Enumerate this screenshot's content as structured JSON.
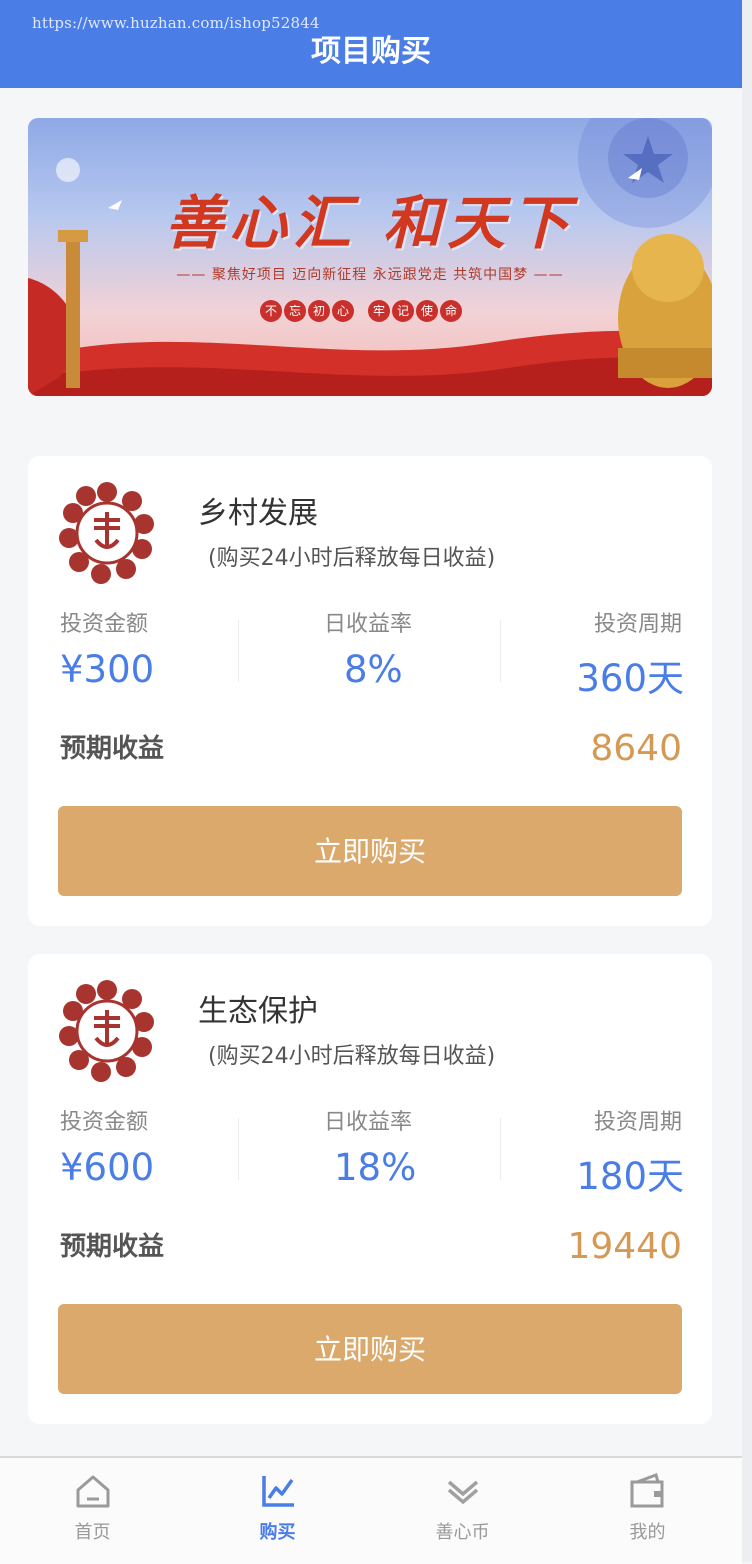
{
  "watermark": "https://www.huzhan.com/ishop52844",
  "header": {
    "title": "项目购买"
  },
  "banner": {
    "slogan": "善心汇 和天下",
    "subline": "—— 聚焦好项目 迈向新征程 永远跟党走 共筑中国梦 ——",
    "pills_left": [
      "不",
      "忘",
      "初",
      "心"
    ],
    "pills_right": [
      "牢",
      "记",
      "使",
      "命"
    ]
  },
  "labels": {
    "amount": "投资金额",
    "rate": "日收益率",
    "period": "投资周期",
    "expected": "预期收益",
    "buy": "立即购买"
  },
  "projects": [
    {
      "name": "乡村发展",
      "note": "(购买24小时后释放每日收益)",
      "amount": "¥300",
      "rate": "8%",
      "period": "360天",
      "expected": "8640"
    },
    {
      "name": "生态保护",
      "note": "(购买24小时后释放每日收益)",
      "amount": "¥600",
      "rate": "18%",
      "period": "180天",
      "expected": "19440"
    }
  ],
  "tabbar": {
    "items": [
      {
        "label": "首页",
        "icon": "home-icon"
      },
      {
        "label": "购买",
        "icon": "chart-icon",
        "active": true
      },
      {
        "label": "善心币",
        "icon": "chevron-double-icon"
      },
      {
        "label": "我的",
        "icon": "wallet-icon"
      }
    ]
  },
  "colors": {
    "header": "#4a7de6",
    "accent_blue": "#4a7de6",
    "gold": "#dba96b",
    "expected_value": "#d49a55"
  }
}
